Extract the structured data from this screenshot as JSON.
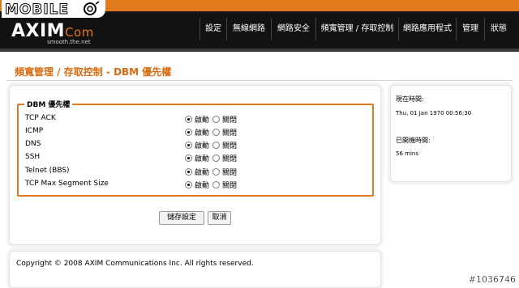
{
  "branding": {
    "watermark_top": "MOBILE",
    "logo_main": "AXIM",
    "logo_suffix": "Com",
    "tagline": "smooth.the.net",
    "watermark_bottom": "#1036746"
  },
  "nav": {
    "items": [
      "設定",
      "無線網路",
      "網路安全",
      "頻寬管理 / 存取控制",
      "網路應用程式",
      "管理",
      "狀態"
    ]
  },
  "page": {
    "title": "頻寬管理 / 存取控制 - DBM 優先權"
  },
  "dbm": {
    "legend": "DBM 優先權",
    "option_on": "啟動",
    "option_off": "關閉",
    "rows": [
      {
        "label": "TCP ACK",
        "value": "啟動"
      },
      {
        "label": "ICMP",
        "value": "啟動"
      },
      {
        "label": "DNS",
        "value": "啟動"
      },
      {
        "label": "SSH",
        "value": "啟動"
      },
      {
        "label": "Telnet (BBS)",
        "value": "啟動"
      },
      {
        "label": "TCP Max Segment Size",
        "value": "啟動"
      }
    ]
  },
  "buttons": {
    "save": "儲存設定",
    "cancel": "取消"
  },
  "footer": {
    "copyright": "Copyright © 2008 AXIM Communications Inc. All rights reserved."
  },
  "status": {
    "current_time_label": "現在時間:",
    "current_time_value": "Thu, 01 Jan 1970 00:56:30",
    "uptime_label": "已開機時間:",
    "uptime_value": "56 mins"
  },
  "colors": {
    "accent": "#e07a1c",
    "header_bg": "#121212"
  }
}
